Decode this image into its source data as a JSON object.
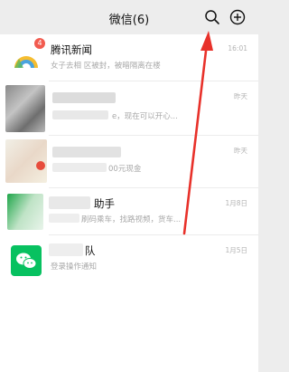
{
  "header": {
    "title": "微信(6)"
  },
  "icons": {
    "search": "search-icon",
    "add": "plus-circle-icon"
  },
  "chats": [
    {
      "name": "腾讯新闻",
      "preview": "女子去相      区被封，被暗隔离在楼",
      "time": "16:01",
      "badge": "4"
    },
    {
      "name": "",
      "preview": "e，现在可以开心...",
      "time": "昨天"
    },
    {
      "name": "",
      "preview": "00元现金",
      "time": "昨天"
    },
    {
      "name": "助手",
      "preview": "刷码乘车，找路视频，货车...",
      "time": "1月8日"
    },
    {
      "name": "队",
      "preview": "登录操作通知",
      "time": "1月5日"
    }
  ],
  "colors": {
    "accent_arrow": "#e8312a",
    "wechat_green": "#07c160",
    "badge_red": "#f25b4f"
  }
}
